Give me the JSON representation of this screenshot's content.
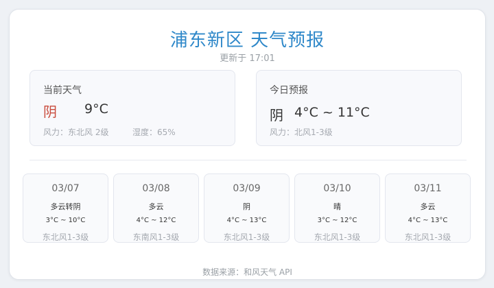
{
  "header": {
    "title": "浦东新区 天气预报",
    "updated": "更新于 17:01"
  },
  "current": {
    "label": "当前天气",
    "condition": "阴",
    "temperature": "9°C",
    "wind": "风力：东北风 2级",
    "humidity": "湿度：65%"
  },
  "today": {
    "label": "今日预报",
    "condition": "阴",
    "range": "4°C ~ 11°C",
    "wind": "风力：北风1-3级"
  },
  "forecast": [
    {
      "date": "03/07",
      "condition": "多云转阴",
      "temp": "3°C ~ 10°C",
      "wind": "东北风1-3级"
    },
    {
      "date": "03/08",
      "condition": "多云",
      "temp": "4°C ~ 12°C",
      "wind": "东南风1-3级"
    },
    {
      "date": "03/09",
      "condition": "阴",
      "temp": "4°C ~ 13°C",
      "wind": "东北风1-3级"
    },
    {
      "date": "03/10",
      "condition": "晴",
      "temp": "3°C ~ 12°C",
      "wind": "东北风1-3级"
    },
    {
      "date": "03/11",
      "condition": "多云",
      "temp": "4°C ~ 13°C",
      "wind": "东北风1-3级"
    }
  ],
  "footer": {
    "source": "数据来源：和风天气 API"
  },
  "colors": {
    "title": "#2f88c9",
    "current_condition": "#c94a3b",
    "muted": "#a5a9b0"
  }
}
